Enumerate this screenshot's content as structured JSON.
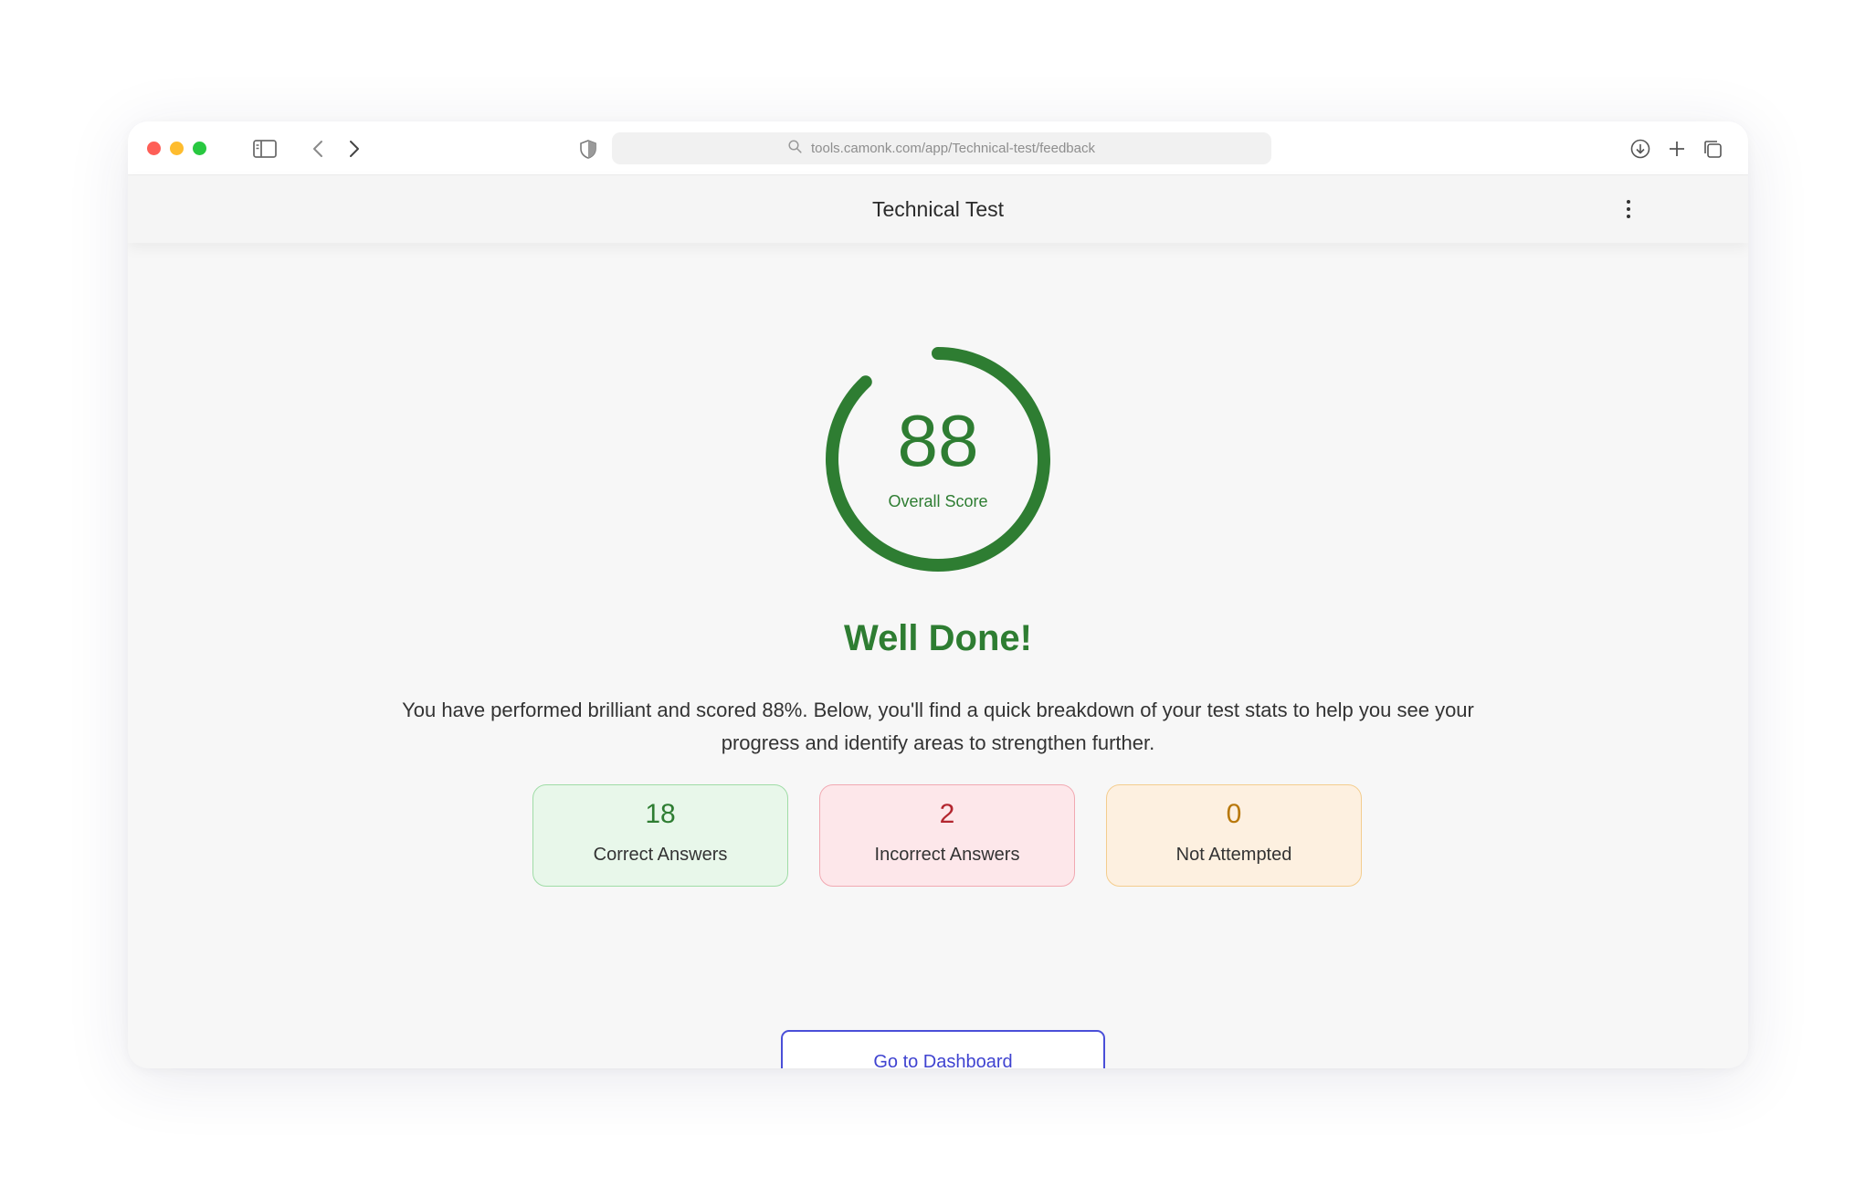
{
  "browser": {
    "url": "tools.camonk.com/app/Technical-test/feedback",
    "icons": [
      "sidebar-toggle-icon",
      "back-arrow-icon",
      "forward-arrow-icon",
      "shield-icon",
      "search-icon",
      "download-icon",
      "plus-icon",
      "tabs-icon"
    ]
  },
  "header": {
    "title": "Technical Test",
    "menu_icon": "kebab-menu-icon"
  },
  "score": {
    "value": "88",
    "label": "Overall Score",
    "progress_percent": 88,
    "color": "#2e7d32"
  },
  "result": {
    "headline": "Well Done!",
    "description": "You have performed brilliant and scored 88%.  Below, you'll find a quick breakdown of your test stats to help you see your progress and identify areas to strengthen further."
  },
  "stats": [
    {
      "value": "18",
      "label": "Correct Answers",
      "value_color": "#2e7d32",
      "bg": "#e8f7ea",
      "border": "#9fdca6"
    },
    {
      "value": "2",
      "label": "Incorrect Answers",
      "value_color": "#b3262f",
      "bg": "#fde7ea",
      "border": "#f1a9b2"
    },
    {
      "value": "0",
      "label": "Not Attempted",
      "value_color": "#b8780a",
      "bg": "#fdf0e0",
      "border": "#f4cd8e"
    }
  ],
  "actions": {
    "dashboard_label": "Go to Dashboard"
  }
}
